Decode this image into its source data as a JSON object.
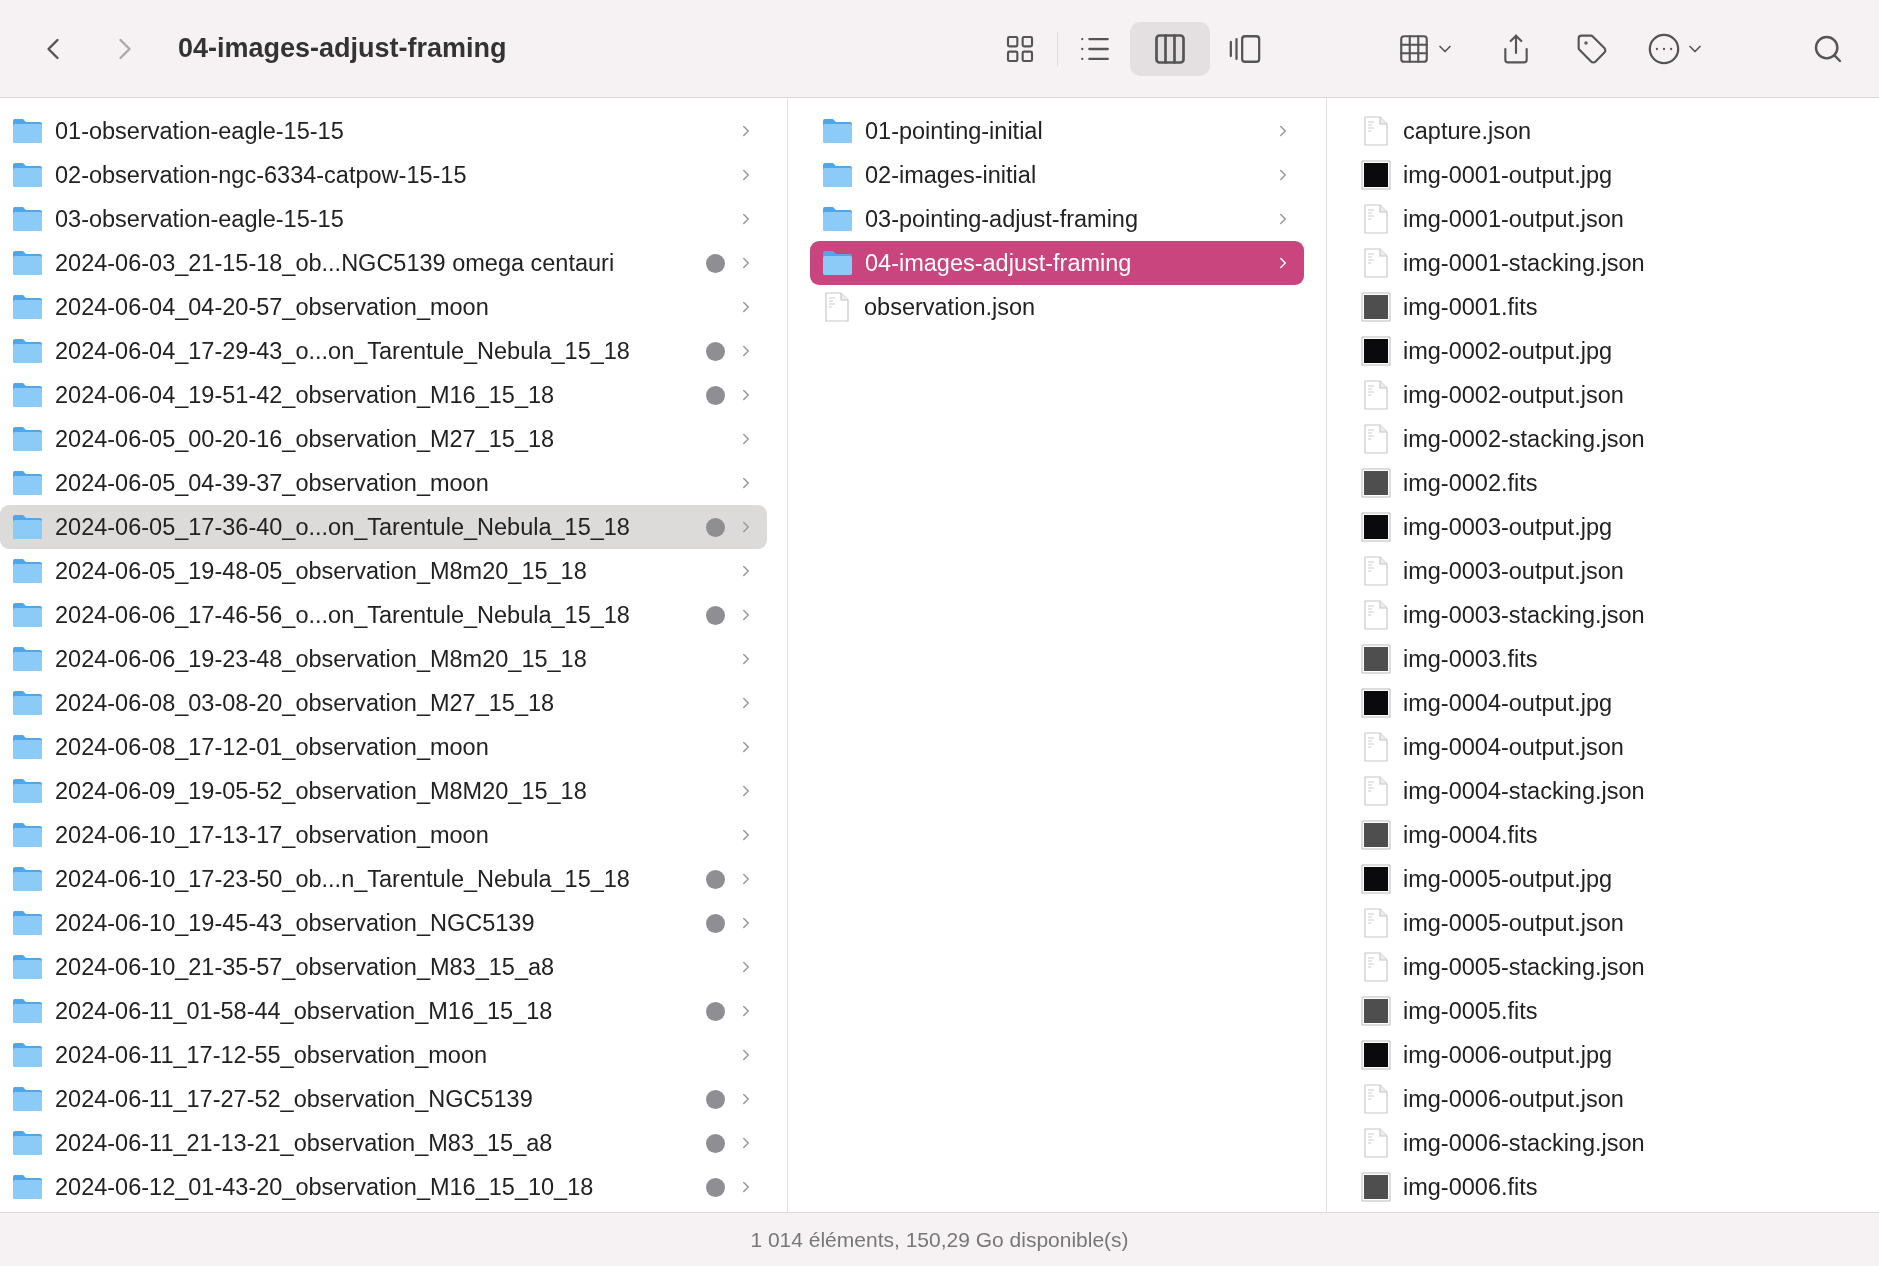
{
  "toolbar": {
    "title": "04-images-adjust-framing",
    "views": [
      {
        "kind": "icons",
        "selected": false
      },
      {
        "kind": "list",
        "selected": false
      },
      {
        "kind": "columns",
        "selected": true
      },
      {
        "kind": "gallery",
        "selected": false
      }
    ]
  },
  "columns": [
    {
      "items": [
        {
          "name": "01-observation-eagle-15-15",
          "tagged": false,
          "selected": false
        },
        {
          "name": "02-observation-ngc-6334-catpow-15-15",
          "tagged": false,
          "selected": false
        },
        {
          "name": "03-observation-eagle-15-15",
          "tagged": false,
          "selected": false
        },
        {
          "name": "2024-06-03_21-15-18_ob...NGC5139 omega centauri",
          "tagged": true,
          "selected": false
        },
        {
          "name": "2024-06-04_04-20-57_observation_moon",
          "tagged": false,
          "selected": false
        },
        {
          "name": "2024-06-04_17-29-43_o...on_Tarentule_Nebula_15_18",
          "tagged": true,
          "selected": false
        },
        {
          "name": "2024-06-04_19-51-42_observation_M16_15_18",
          "tagged": true,
          "selected": false
        },
        {
          "name": "2024-06-05_00-20-16_observation_M27_15_18",
          "tagged": false,
          "selected": false
        },
        {
          "name": "2024-06-05_04-39-37_observation_moon",
          "tagged": false,
          "selected": false
        },
        {
          "name": "2024-06-05_17-36-40_o...on_Tarentule_Nebula_15_18",
          "tagged": true,
          "selected": true
        },
        {
          "name": "2024-06-05_19-48-05_observation_M8m20_15_18",
          "tagged": false,
          "selected": false
        },
        {
          "name": "2024-06-06_17-46-56_o...on_Tarentule_Nebula_15_18",
          "tagged": true,
          "selected": false
        },
        {
          "name": "2024-06-06_19-23-48_observation_M8m20_15_18",
          "tagged": false,
          "selected": false
        },
        {
          "name": "2024-06-08_03-08-20_observation_M27_15_18",
          "tagged": false,
          "selected": false
        },
        {
          "name": "2024-06-08_17-12-01_observation_moon",
          "tagged": false,
          "selected": false
        },
        {
          "name": "2024-06-09_19-05-52_observation_M8M20_15_18",
          "tagged": false,
          "selected": false
        },
        {
          "name": "2024-06-10_17-13-17_observation_moon",
          "tagged": false,
          "selected": false
        },
        {
          "name": "2024-06-10_17-23-50_ob...n_Tarentule_Nebula_15_18",
          "tagged": true,
          "selected": false
        },
        {
          "name": "2024-06-10_19-45-43_observation_NGC5139",
          "tagged": true,
          "selected": false
        },
        {
          "name": "2024-06-10_21-35-57_observation_M83_15_a8",
          "tagged": false,
          "selected": false
        },
        {
          "name": "2024-06-11_01-58-44_observation_M16_15_18",
          "tagged": true,
          "selected": false
        },
        {
          "name": "2024-06-11_17-12-55_observation_moon",
          "tagged": false,
          "selected": false
        },
        {
          "name": "2024-06-11_17-27-52_observation_NGC5139",
          "tagged": true,
          "selected": false
        },
        {
          "name": "2024-06-11_21-13-21_observation_M83_15_a8",
          "tagged": true,
          "selected": false
        },
        {
          "name": "2024-06-12_01-43-20_observation_M16_15_10_18",
          "tagged": true,
          "selected": false
        }
      ]
    },
    {
      "items": [
        {
          "name": "01-pointing-initial",
          "kind": "folder",
          "selected": false
        },
        {
          "name": "02-images-initial",
          "kind": "folder",
          "selected": false
        },
        {
          "name": "03-pointing-adjust-framing",
          "kind": "folder",
          "selected": false
        },
        {
          "name": "04-images-adjust-framing",
          "kind": "folder",
          "selected": true
        },
        {
          "name": "observation.json",
          "kind": "json",
          "selected": false
        }
      ]
    },
    {
      "items": [
        {
          "name": "capture.json",
          "kind": "json"
        },
        {
          "name": "img-0001-output.jpg",
          "kind": "jpg"
        },
        {
          "name": "img-0001-output.json",
          "kind": "json"
        },
        {
          "name": "img-0001-stacking.json",
          "kind": "json"
        },
        {
          "name": "img-0001.fits",
          "kind": "fits"
        },
        {
          "name": "img-0002-output.jpg",
          "kind": "jpg"
        },
        {
          "name": "img-0002-output.json",
          "kind": "json"
        },
        {
          "name": "img-0002-stacking.json",
          "kind": "json"
        },
        {
          "name": "img-0002.fits",
          "kind": "fits"
        },
        {
          "name": "img-0003-output.jpg",
          "kind": "jpg"
        },
        {
          "name": "img-0003-output.json",
          "kind": "json"
        },
        {
          "name": "img-0003-stacking.json",
          "kind": "json"
        },
        {
          "name": "img-0003.fits",
          "kind": "fits"
        },
        {
          "name": "img-0004-output.jpg",
          "kind": "jpg"
        },
        {
          "name": "img-0004-output.json",
          "kind": "json"
        },
        {
          "name": "img-0004-stacking.json",
          "kind": "json"
        },
        {
          "name": "img-0004.fits",
          "kind": "fits"
        },
        {
          "name": "img-0005-output.jpg",
          "kind": "jpg"
        },
        {
          "name": "img-0005-output.json",
          "kind": "json"
        },
        {
          "name": "img-0005-stacking.json",
          "kind": "json"
        },
        {
          "name": "img-0005.fits",
          "kind": "fits"
        },
        {
          "name": "img-0006-output.jpg",
          "kind": "jpg"
        },
        {
          "name": "img-0006-output.json",
          "kind": "json"
        },
        {
          "name": "img-0006-stacking.json",
          "kind": "json"
        },
        {
          "name": "img-0006.fits",
          "kind": "fits"
        }
      ]
    }
  ],
  "status_bar": "1 014 éléments, 150,29 Go disponible(s)"
}
